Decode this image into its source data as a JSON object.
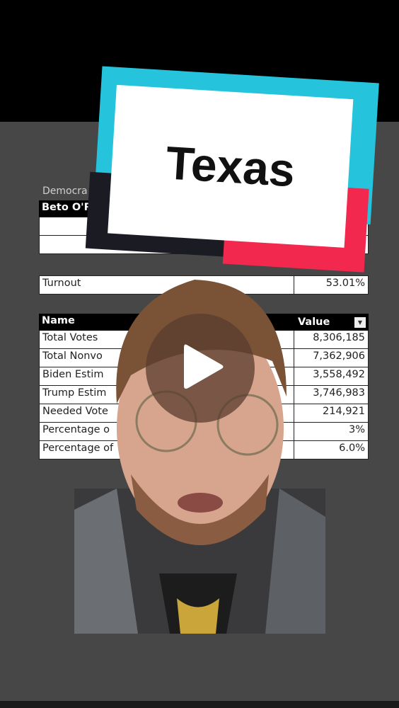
{
  "sticker": {
    "title": "Texas",
    "colors": {
      "cyan": "#25c4dc",
      "red": "#f2284f",
      "dark": "#1b1b24"
    }
  },
  "sheet": {
    "subtitle": "Democra",
    "top_table": {
      "header": "Beto O'R"
    },
    "turnout": {
      "label": "Turnout",
      "value": "53.01%"
    },
    "main_table": {
      "headers": [
        "Name",
        "Value"
      ],
      "rows": [
        {
          "name": "Total Votes",
          "value": "8,306,185"
        },
        {
          "name": "Total Nonvo",
          "value": "7,362,906"
        },
        {
          "name": "Biden Estim",
          "value": "3,558,492"
        },
        {
          "name": "Trump Estim",
          "value": "3,746,983"
        },
        {
          "name": "Needed Vote",
          "value": "214,921"
        },
        {
          "name": "Percentage o",
          "value": "3%"
        },
        {
          "name": "Percentage of",
          "value": "6.0%"
        }
      ]
    }
  },
  "video": {
    "play_icon": "play-icon"
  }
}
